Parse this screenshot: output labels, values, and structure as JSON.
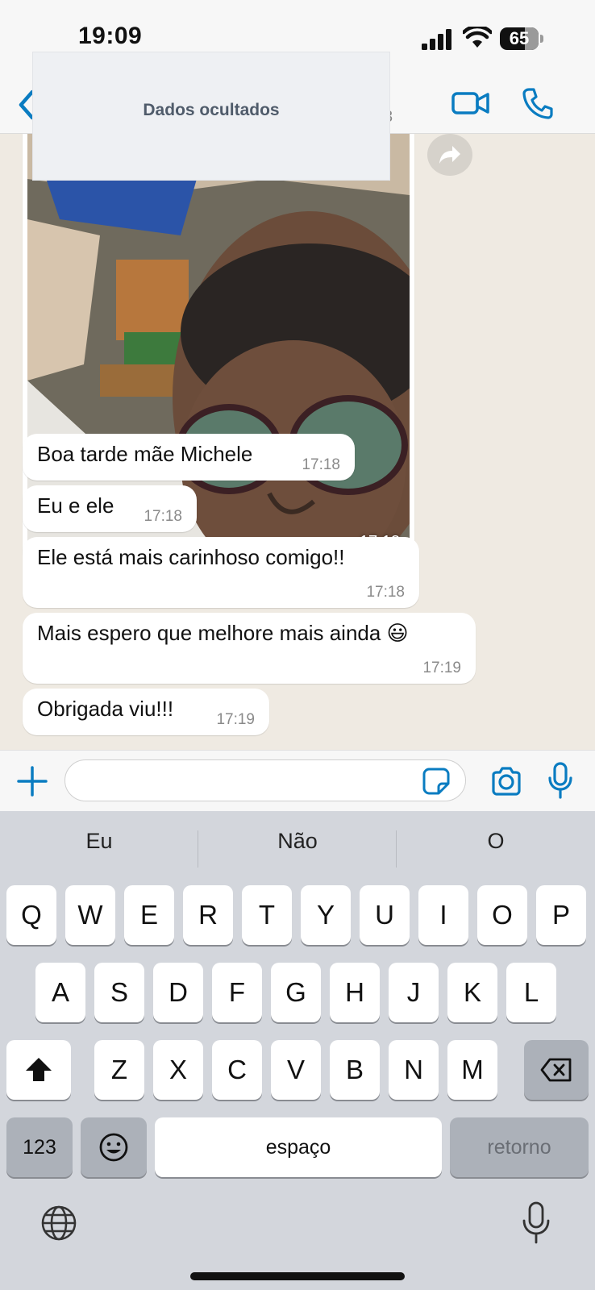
{
  "status_bar": {
    "time": "19:09",
    "battery": "65",
    "battery_level": 0.65
  },
  "header": {
    "hidden_text": "Dados ocultados",
    "title_fragment": "3"
  },
  "messages": [
    {
      "text": "Boa tarde mãe Michele",
      "time": "17:18"
    },
    {
      "text": "Eu e ele",
      "time": "17:18"
    },
    {
      "text": "Ele está mais carinhoso comigo!!",
      "time": "17:18"
    },
    {
      "text": "Mais espero que melhore mais ainda 😃",
      "time": "17:19"
    },
    {
      "text": "Obrigada viu!!!",
      "time": "17:19"
    }
  ],
  "image_message": {
    "time": "17:18"
  },
  "input": {
    "value": "",
    "placeholder": ""
  },
  "keyboard": {
    "suggestions": [
      "Eu",
      "Não",
      "O"
    ],
    "row1": [
      "Q",
      "W",
      "E",
      "R",
      "T",
      "Y",
      "U",
      "I",
      "O",
      "P"
    ],
    "row2": [
      "A",
      "S",
      "D",
      "F",
      "G",
      "H",
      "J",
      "K",
      "L"
    ],
    "row3": [
      "Z",
      "X",
      "C",
      "V",
      "B",
      "N",
      "M"
    ],
    "numbers": "123",
    "space": "espaço",
    "return": "retorno"
  },
  "colors": {
    "accent": "#0a7cc1",
    "chat_bg": "#efeae2",
    "bubble": "#ffffff",
    "keyboard_bg": "#d3d6dc"
  }
}
